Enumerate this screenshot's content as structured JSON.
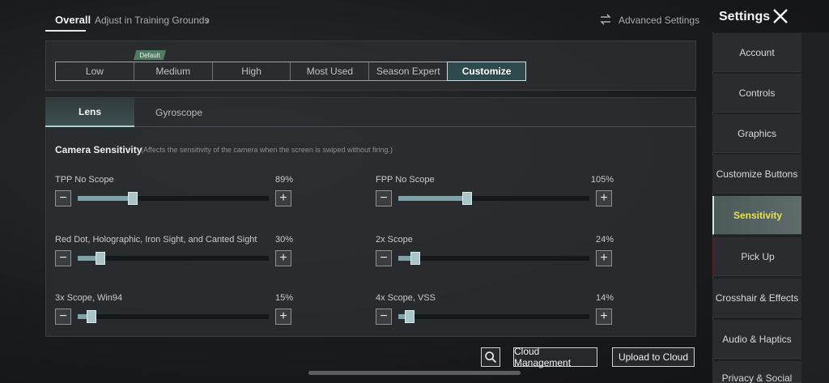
{
  "header": {
    "tab_overall": "Overall",
    "tab_training": "Adjust in Training Grounds",
    "advanced_settings": "Advanced Settings",
    "settings_title": "Settings"
  },
  "presets": {
    "default_badge": "Default",
    "items": [
      "Low",
      "Medium",
      "High",
      "Most Used",
      "Season Expert",
      "Customize"
    ],
    "selected": "Customize"
  },
  "subtabs": {
    "lens": "Lens",
    "gyroscope": "Gyroscope",
    "selected": "Lens"
  },
  "camera": {
    "title": "Camera Sensitivity",
    "note": "(Affects the sensitivity of the camera when the screen is swiped without firing.)"
  },
  "sliders": [
    {
      "label": "TPP No Scope",
      "value": "89%",
      "level": 0.29
    },
    {
      "label": "FPP No Scope",
      "value": "105%",
      "level": 0.36
    },
    {
      "label": "Red Dot, Holographic, Iron Sight, and Canted Sight",
      "value": "30%",
      "level": 0.12
    },
    {
      "label": "2x Scope",
      "value": "24%",
      "level": 0.09
    },
    {
      "label": "3x Scope, Win94",
      "value": "15%",
      "level": 0.07
    },
    {
      "label": "4x Scope, VSS",
      "value": "14%",
      "level": 0.06
    }
  ],
  "footer": {
    "cloud_management": "Cloud Management",
    "upload_to_cloud": "Upload to Cloud"
  },
  "sidebar": {
    "items": [
      "Account",
      "Controls",
      "Graphics",
      "Customize Buttons",
      "Sensitivity",
      "Pick Up",
      "Crosshair & Effects",
      "Audio & Haptics",
      "Privacy & Social"
    ],
    "selected": "Sensitivity"
  },
  "colors": {
    "accent": "#7ea2a6",
    "active_text": "#e8e34a",
    "default_badge": "#4f7a63"
  }
}
